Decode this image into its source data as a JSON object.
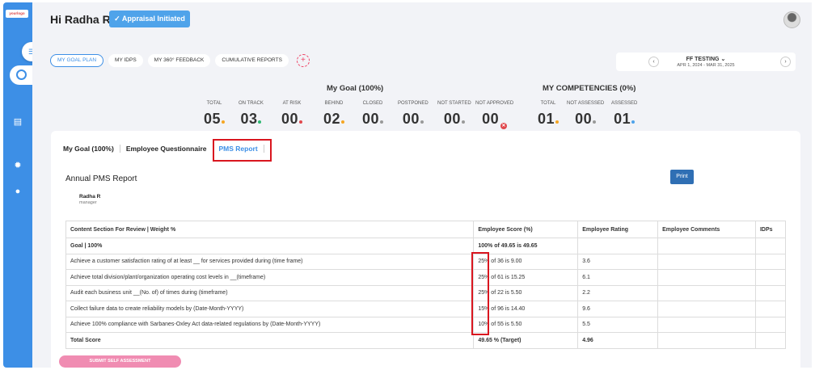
{
  "sidebar": {
    "logo_text": "yourlogo"
  },
  "header": {
    "greeting": "Hi Radha R",
    "status": "Appraisal Initiated"
  },
  "tabs": [
    {
      "label": "MY GOAL PLAN",
      "active": true
    },
    {
      "label": "MY IDPS"
    },
    {
      "label": "MY 360° FEEDBACK"
    },
    {
      "label": "CUMULATIVE REPORTS"
    }
  ],
  "period": {
    "name": "FF TESTING",
    "range": "APR 1, 2024 - MAR 31, 2025"
  },
  "goal_summary": {
    "title": "My Goal (100%)",
    "stats": [
      {
        "label": "TOTAL",
        "value": "05",
        "dot": "#f5a623"
      },
      {
        "label": "ON TRACK",
        "value": "03",
        "dot": "#2eb872"
      },
      {
        "label": "AT RISK",
        "value": "00",
        "dot": "#e0474c"
      },
      {
        "label": "BEHIND",
        "value": "02",
        "dot": "#f5a623"
      },
      {
        "label": "CLOSED",
        "value": "00",
        "dot": "#999999"
      },
      {
        "label": "POSTPONED",
        "value": "00",
        "dot": "#999999"
      },
      {
        "label": "NOT STARTED",
        "value": "00",
        "dot": "#999999"
      },
      {
        "label": "NOT APPROVED",
        "value": "00",
        "dot": "x"
      }
    ]
  },
  "competency_summary": {
    "title": "MY COMPETENCIES (0%)",
    "stats": [
      {
        "label": "TOTAL",
        "value": "01",
        "dot": "#f5a623"
      },
      {
        "label": "NOT ASSESSED",
        "value": "00",
        "dot": "#999999"
      },
      {
        "label": "ASSESSED",
        "value": "01",
        "dot": "#4fa3ea"
      }
    ]
  },
  "subtabs": [
    "My Goal (100%)",
    "Employee Questionnaire",
    "PMS Report"
  ],
  "report": {
    "title": "Annual PMS Report",
    "print_label": "Print",
    "person_name": "Radha R",
    "person_role": "manager",
    "headers": [
      "Content Section For Review | Weight %",
      "Employee Score (%)",
      "Employee Rating",
      "Employee Comments",
      "IDPs"
    ],
    "rows": [
      {
        "section": "Goal | 100%",
        "score": "100% of 49.65 is 49.65",
        "rating": "",
        "comments": "",
        "idps": "",
        "bold": true
      },
      {
        "section": "Achieve a customer satisfaction rating of at least __ for services provided during (time frame)",
        "score": "25% of 36 is 9.00",
        "rating": "3.6",
        "comments": "",
        "idps": ""
      },
      {
        "section": "Achieve total division/plant/organization operating cost levels in __(timeframe)",
        "score": "25% of 61 is 15.25",
        "rating": "6.1",
        "comments": "",
        "idps": ""
      },
      {
        "section": "Audit each business unit __(No. of) of times during (timeframe)",
        "score": "25% of 22 is 5.50",
        "rating": "2.2",
        "comments": "",
        "idps": ""
      },
      {
        "section": "Collect failure data to create reliability models by (Date-Month-YYYY)",
        "score": "15% of 96 is 14.40",
        "rating": "9.6",
        "comments": "",
        "idps": ""
      },
      {
        "section": "Achieve 100% compliance with Sarbanes-Oxley Act data-related regulations by (Date-Month-YYYY)",
        "score": "10% of 55 is 5.50",
        "rating": "5.5",
        "comments": "",
        "idps": ""
      },
      {
        "section": "Total Score",
        "score": "49.65 % (Target)",
        "rating": "4.96",
        "comments": "",
        "idps": "",
        "bold": true
      }
    ]
  },
  "submit_label": "SUBMIT SELF ASSESSMENT"
}
